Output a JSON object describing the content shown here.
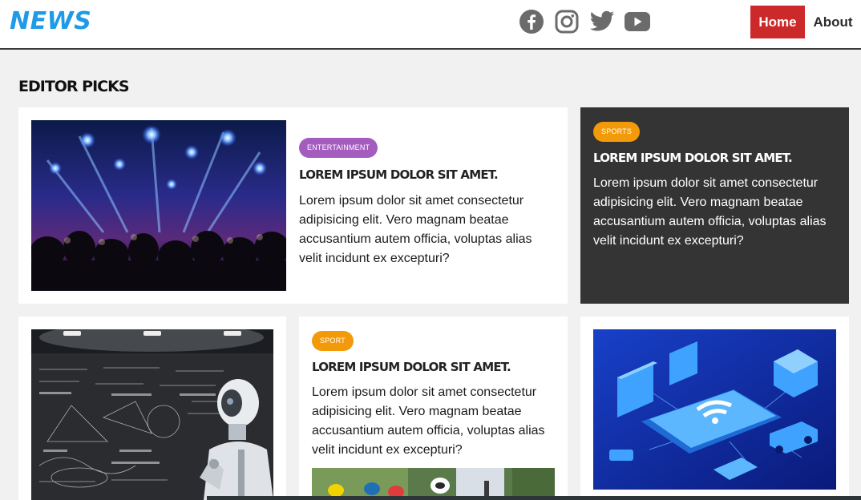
{
  "header": {
    "logo": "NEWS",
    "socials": [
      {
        "name": "facebook-icon"
      },
      {
        "name": "instagram-icon"
      },
      {
        "name": "twitter-icon"
      },
      {
        "name": "youtube-icon"
      }
    ],
    "nav": {
      "home": "Home",
      "about": "About"
    }
  },
  "section_title": "EDITOR PICKS",
  "cards": {
    "card1": {
      "badge": "ENTERTAINMENT",
      "headline": "LOREM IPSUM DOLOR SIT AMET.",
      "excerpt": "Lorem ipsum dolor sit amet consectetur adipisicing elit. Vero magnam beatae accusantium autem officia, voluptas alias velit incidunt ex excepturi?"
    },
    "card2": {
      "badge": "SPORTS",
      "headline": "LOREM IPSUM DOLOR SIT AMET.",
      "excerpt": "Lorem ipsum dolor sit amet consectetur adipisicing elit. Vero magnam beatae accusantium autem officia, voluptas alias velit incidunt ex excepturi?"
    },
    "card4": {
      "badge": "SPORT",
      "headline": "LOREM IPSUM DOLOR SIT AMET.",
      "excerpt": "Lorem ipsum dolor sit amet consectetur adipisicing elit. Vero magnam beatae accusantium autem officia, voluptas alias velit incidunt ex excepturi?"
    }
  },
  "colors": {
    "logo": "#1e9be6",
    "home_nav": "#cc2a2a",
    "badge_entertainment": "#a45cbf",
    "badge_sport": "#f29a0a",
    "dark_card": "#343434"
  }
}
